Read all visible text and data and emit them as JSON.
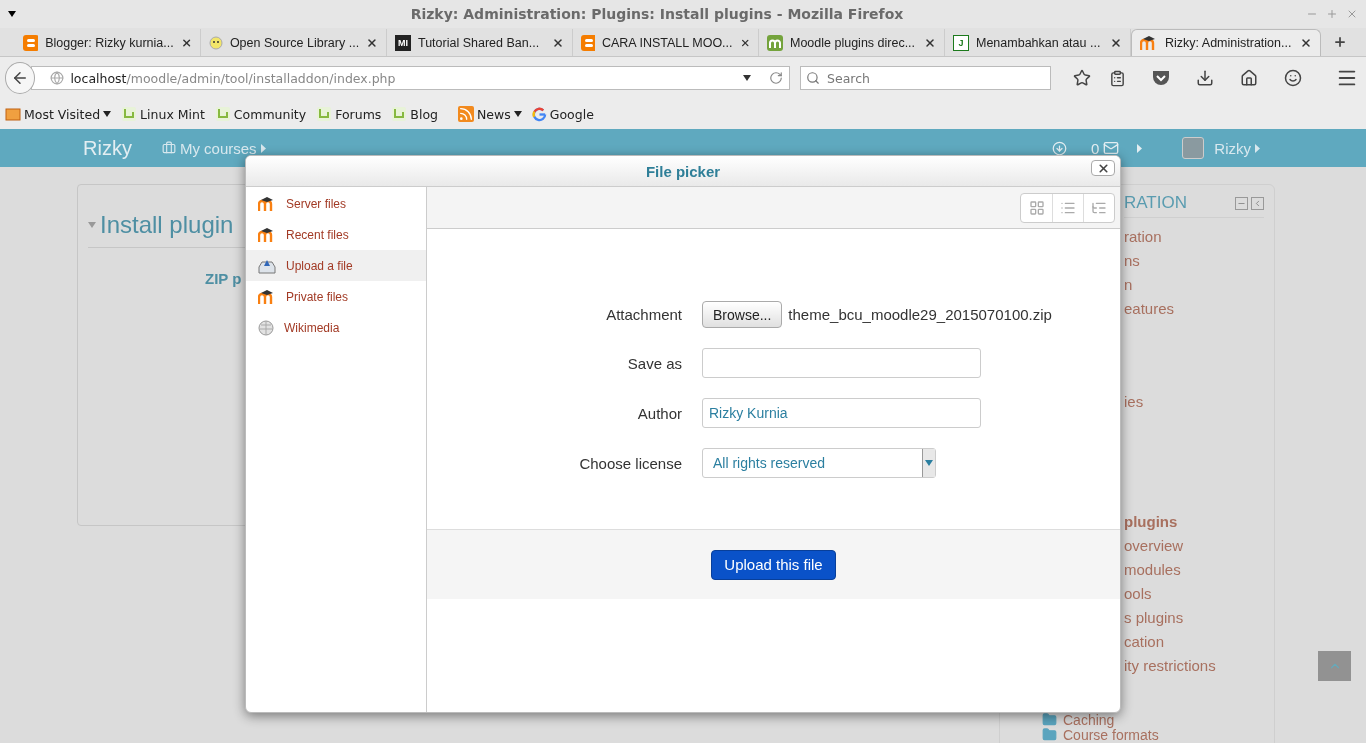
{
  "window": {
    "title": "Rizky: Administration: Plugins: Install plugins - Mozilla Firefox"
  },
  "tabs": [
    {
      "label": "Blogger: Rizky kurnia...",
      "kind": "blogger",
      "selected": false
    },
    {
      "label": "Open Source Library ...",
      "kind": "smiley",
      "selected": false
    },
    {
      "label": "Tutorial Shared Ban...",
      "kind": "letters",
      "badge": "MI",
      "selected": false
    },
    {
      "label": "CARA INSTALL MOO...",
      "kind": "blogger",
      "selected": false
    },
    {
      "label": "Moodle plugins direc...",
      "kind": "moodle-green",
      "selected": false
    },
    {
      "label": "Menambahkan atau ...",
      "kind": "letters",
      "badge": "J",
      "selected": false
    },
    {
      "label": "Rizky: Administration...",
      "kind": "moodle",
      "selected": true
    }
  ],
  "address": {
    "host": "localhost",
    "path": "/moodle/admin/tool/installaddon/index.php"
  },
  "search": {
    "placeholder": "Search"
  },
  "bookmarks": [
    {
      "label": "Most Visited",
      "kind": "folder",
      "dropdown": true
    },
    {
      "label": "Linux Mint",
      "kind": "mint",
      "dropdown": false
    },
    {
      "label": "Community",
      "kind": "mint",
      "dropdown": false
    },
    {
      "label": "Forums",
      "kind": "mint",
      "dropdown": false
    },
    {
      "label": "Blog",
      "kind": "mint",
      "dropdown": false
    },
    {
      "label": "News",
      "kind": "rss",
      "dropdown": true
    },
    {
      "label": "Google",
      "kind": "google",
      "dropdown": false
    }
  ],
  "navbar": {
    "brand": "Rizky",
    "my_courses": "My courses",
    "message_count": "0",
    "user": "Rizky"
  },
  "page": {
    "heading": "Install plugin",
    "zip_label": "ZIP p"
  },
  "admin_block": {
    "title": "RATION",
    "items": [
      {
        "label": "ration",
        "bold": false,
        "kind": "link"
      },
      {
        "label": "ns",
        "bold": false,
        "kind": "link"
      },
      {
        "label": "n",
        "bold": false,
        "kind": "link"
      },
      {
        "label": "eatures",
        "bold": false,
        "kind": "link"
      },
      {
        "label": "ies",
        "bold": false,
        "kind": "link"
      },
      {
        "label": "plugins",
        "bold": true,
        "kind": "link"
      },
      {
        "label": "overview",
        "bold": false,
        "kind": "link"
      },
      {
        "label": "modules",
        "bold": false,
        "kind": "link"
      },
      {
        "label": "ools",
        "bold": false,
        "kind": "link"
      },
      {
        "label": "s plugins",
        "bold": false,
        "kind": "link"
      },
      {
        "label": "cation",
        "bold": false,
        "kind": "link"
      },
      {
        "label": "ity restrictions",
        "bold": false,
        "kind": "link"
      },
      {
        "label": "Caching",
        "bold": false,
        "kind": "folder"
      },
      {
        "label": "Course formats",
        "bold": false,
        "kind": "folder"
      }
    ]
  },
  "dialog": {
    "title": "File picker",
    "sources": [
      {
        "label": "Server files",
        "kind": "moodle",
        "selected": false
      },
      {
        "label": "Recent files",
        "kind": "moodle",
        "selected": false
      },
      {
        "label": "Upload a file",
        "kind": "upload",
        "selected": true
      },
      {
        "label": "Private files",
        "kind": "moodle",
        "selected": false
      },
      {
        "label": "Wikimedia",
        "kind": "wiki",
        "selected": false
      }
    ],
    "views": [
      {
        "kind": "grid"
      },
      {
        "kind": "list"
      },
      {
        "kind": "tree"
      }
    ],
    "attachment": {
      "label": "Attachment",
      "button": "Browse...",
      "filename": "theme_bcu_moodle29_2015070100.zip"
    },
    "save_as": {
      "label": "Save as"
    },
    "author": {
      "label": "Author",
      "value": "Rizky Kurnia"
    },
    "license": {
      "label": "Choose license",
      "value": "All rights reserved"
    },
    "upload_button": "Upload this file"
  }
}
